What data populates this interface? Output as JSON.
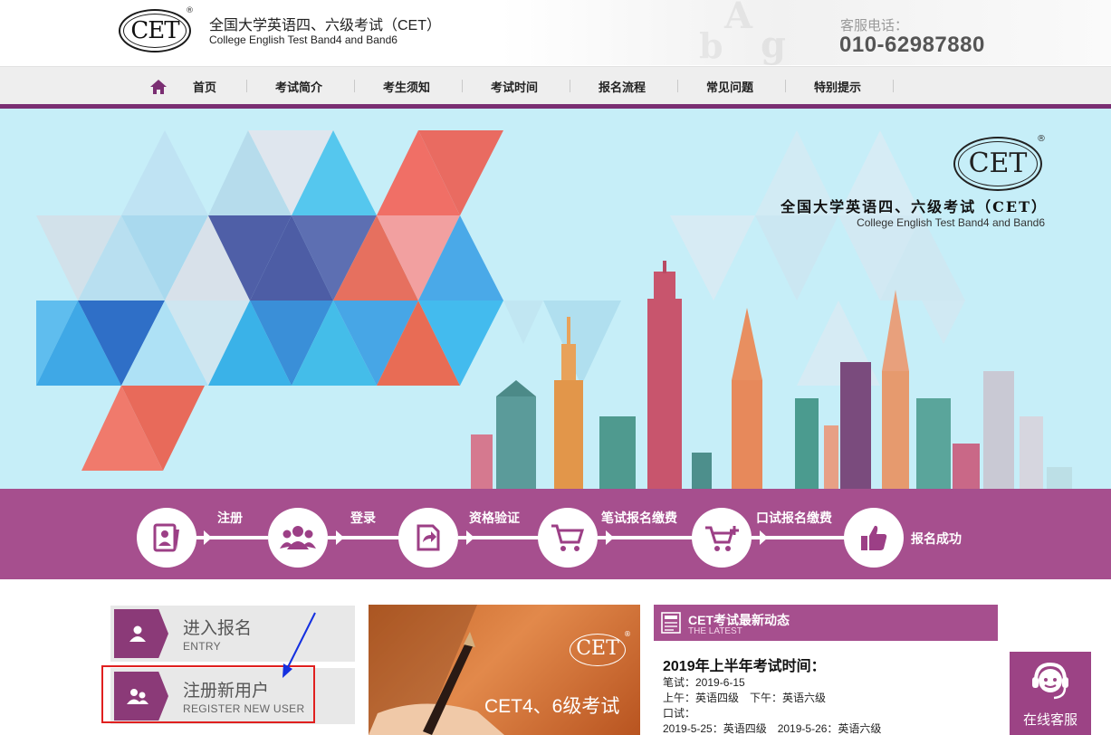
{
  "header": {
    "logo_text": "CET",
    "logo_mark": "®",
    "title_cn": "全国大学英语四、六级考试（CET）",
    "title_en": "College English Test Band4 and Band6",
    "phone_label": "客服电话：",
    "phone_number": "010-62987880"
  },
  "nav": {
    "home_icon": "home-icon",
    "items": [
      {
        "label": "首页"
      },
      {
        "label": "考试简介"
      },
      {
        "label": "考生须知"
      },
      {
        "label": "考试时间"
      },
      {
        "label": "报名流程"
      },
      {
        "label": "常见问题"
      },
      {
        "label": "特别提示"
      }
    ],
    "accent_color": "#7a2e72"
  },
  "banner": {
    "logo_text": "CET",
    "logo_mark": "®",
    "title_cn": "全国大学英语四、六级考试（CET）",
    "title_en": "College English Test Band4 and Band6"
  },
  "process": {
    "steps": [
      {
        "label": "注册",
        "icon": "id-card-icon"
      },
      {
        "label": "登录",
        "icon": "users-icon"
      },
      {
        "label": "资格验证",
        "icon": "verify-icon"
      },
      {
        "label": "笔试报名缴费",
        "icon": "cart-icon"
      },
      {
        "label": "口试报名缴费",
        "icon": "cart-plus-icon"
      },
      {
        "label": "报名成功",
        "icon": "thumbs-up-icon"
      }
    ],
    "color": "#a64f8e"
  },
  "sidebar": {
    "buttons": [
      {
        "title": "进入报名",
        "sub": "ENTRY",
        "icon": "user-icon"
      },
      {
        "title": "注册新用户",
        "sub": "REGISTER NEW USER",
        "icon": "users-icon"
      }
    ]
  },
  "promo": {
    "logo_text": "CET",
    "logo_mark": "®",
    "text": "CET4、6级考试"
  },
  "news": {
    "title": "CET考试最新动态",
    "latest": "THE LATEST",
    "heading": "2019年上半年考试时间：",
    "lines": [
      "笔试：2019-6-15",
      "上午：英语四级　下午：英语六级",
      "口试：",
      "2019-5-25：英语四级　2019-5-26：英语六级"
    ]
  },
  "service": {
    "label": "在线客服",
    "icon": "headset-icon"
  }
}
